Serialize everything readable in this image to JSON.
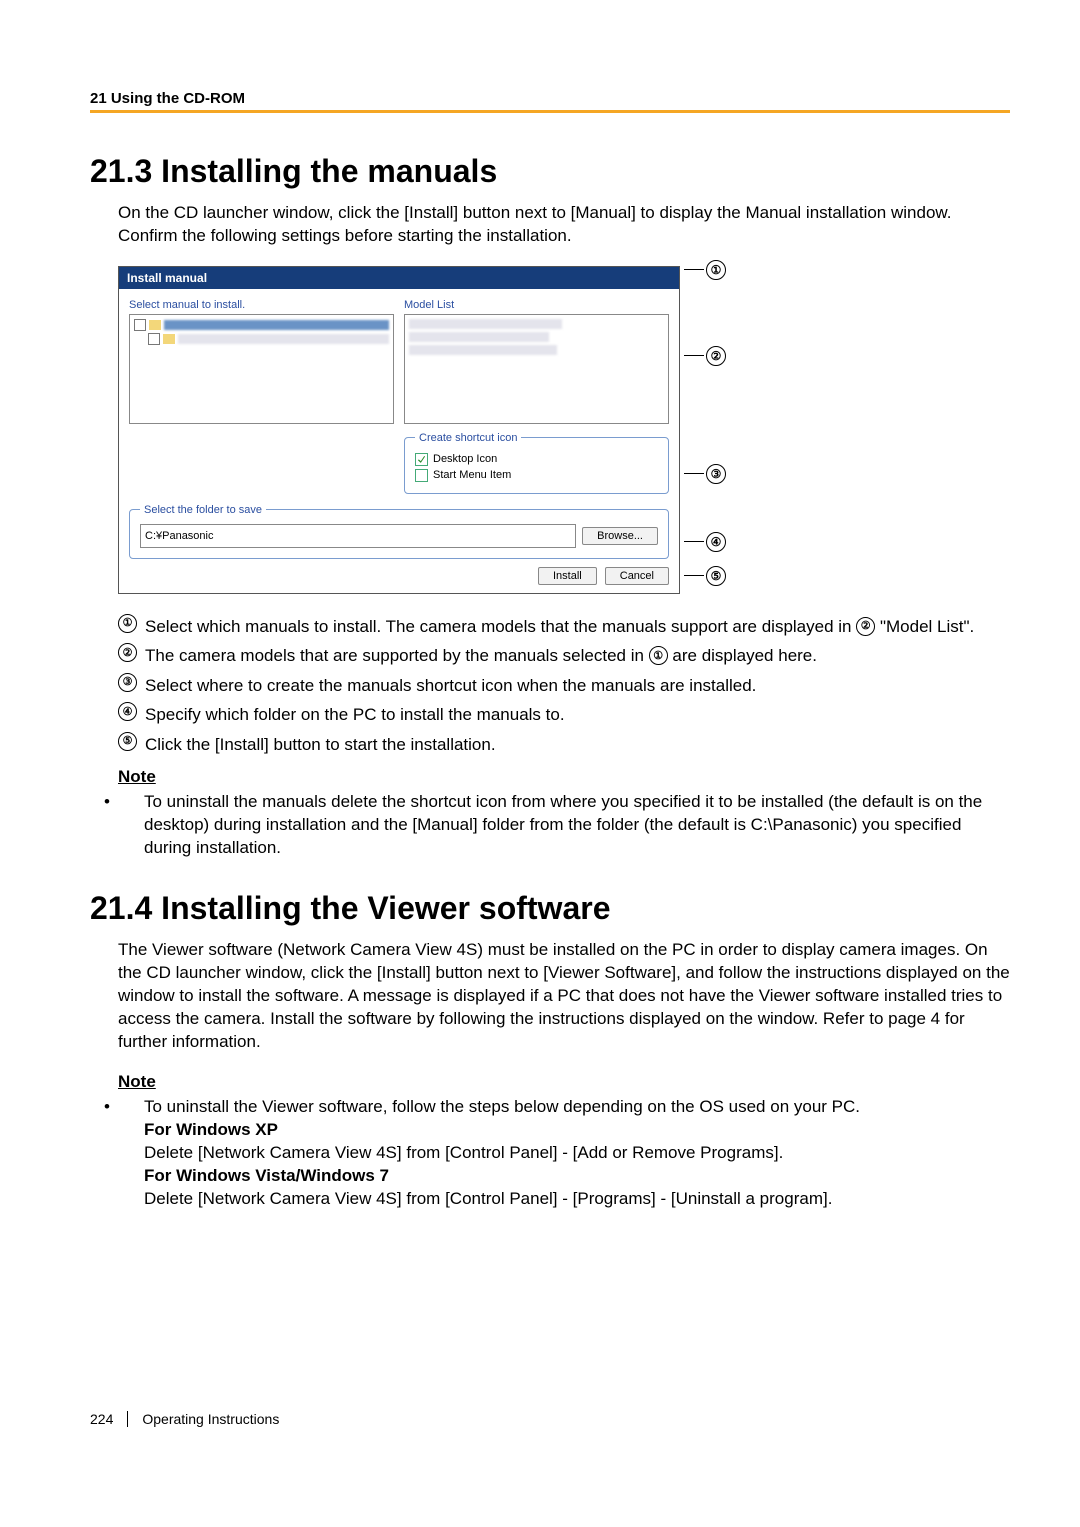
{
  "header": {
    "section_title": "21 Using the CD-ROM"
  },
  "s213": {
    "heading": "21.3   Installing the manuals",
    "intro": "On the CD launcher window, click the [Install] button next to [Manual] to display the Manual installation window. Confirm the following settings before starting the installation.",
    "dialog": {
      "title": "Install manual",
      "select_label": "Select manual to install.",
      "model_list_label": "Model List",
      "shortcut_legend": "Create shortcut icon",
      "opt_desktop": "Desktop Icon",
      "opt_startmenu": "Start Menu Item",
      "folder_legend": "Select the folder to save",
      "folder_value": "C:¥Panasonic",
      "browse": "Browse...",
      "install": "Install",
      "cancel": "Cancel"
    },
    "callouts": [
      "①",
      "②",
      "③",
      "④",
      "⑤"
    ],
    "items": [
      {
        "n": "①",
        "pre": "Select which manuals to install. The camera models that the manuals support are displayed in ",
        "inl": "②",
        "post": " \"Model List\"."
      },
      {
        "n": "②",
        "pre": "The camera models that are supported by the manuals selected in ",
        "inl": "①",
        "post": " are displayed here."
      },
      {
        "n": "③",
        "text": "Select where to create the manuals shortcut icon when the manuals are installed."
      },
      {
        "n": "④",
        "text": "Specify which folder on the PC to install the manuals to."
      },
      {
        "n": "⑤",
        "text": "Click the [Install] button to start the installation."
      }
    ],
    "note_heading": "Note",
    "note_body": "To uninstall the manuals delete the shortcut icon from where you specified it to be installed (the default is on the desktop) during installation and the [Manual] folder from the folder (the default is C:\\Panasonic) you specified during installation."
  },
  "s214": {
    "heading": "21.4   Installing the Viewer software",
    "intro": "The Viewer software (Network Camera View 4S) must be installed on the PC in order to display camera images. On the CD launcher window, click the [Install] button next to [Viewer Software], and follow the instructions displayed on the window to install the software. A message is displayed if a PC that does not have the Viewer software installed tries to access the camera. Install the software by following the instructions displayed on the window. Refer to page 4 for further information.",
    "note_heading": "Note",
    "note_intro": "To uninstall the Viewer software, follow the steps below depending on the OS used on your PC.",
    "xp_h": "For Windows XP",
    "xp_b": "Delete [Network Camera View 4S] from [Control Panel] - [Add or Remove Programs].",
    "vista_h": "For Windows Vista/Windows 7",
    "vista_b": "Delete [Network Camera View 4S] from [Control Panel] - [Programs] - [Uninstall a program]."
  },
  "footer": {
    "page": "224",
    "label": "Operating Instructions"
  }
}
